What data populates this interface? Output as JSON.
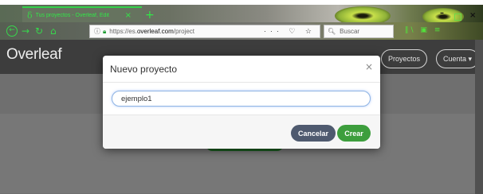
{
  "browser": {
    "tab_title": "Tus proyectos - Overleaf, Edit",
    "tab_close": "×",
    "new_tab": "+",
    "url_prefix": "https://es.",
    "url_domain": "overleaf.com",
    "url_path": "/project",
    "url_extras": "··· ♡ ☆",
    "search_placeholder": "Buscar",
    "icons": [
      "back-icon",
      "forward-icon",
      "reload-icon",
      "home-icon",
      "info-icon",
      "lock-icon",
      "search-icon",
      "library-icon",
      "sidebar-icon",
      "menu-icon"
    ],
    "window_min": "–",
    "window_close": "×"
  },
  "overleaf": {
    "logo": "Overleaf",
    "header_buttons": {
      "projects": "Proyectos",
      "account": "Cuenta ▾"
    }
  },
  "modal": {
    "title": "Nuevo proyecto",
    "close": "×",
    "input_value": "ejemplo1",
    "cancel_label": "Cancelar",
    "create_label": "Crear"
  },
  "colors": {
    "accent_green": "#3d9e3d",
    "cancel_slate": "#4f5a6f",
    "browser_theme_green": "#32e648"
  }
}
